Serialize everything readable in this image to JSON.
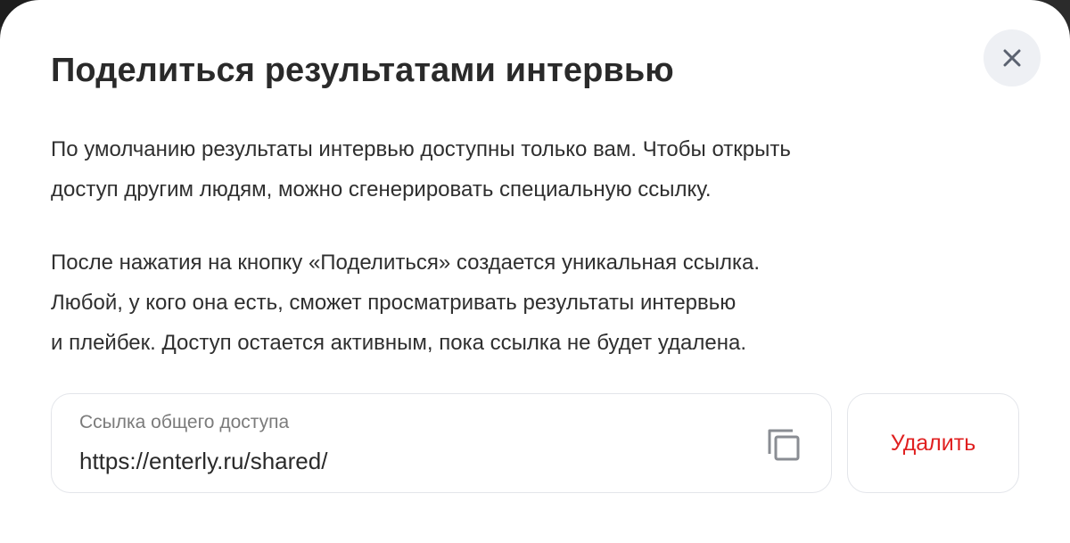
{
  "modal": {
    "title": "Поделиться результатами интервью",
    "close_icon": "close-icon",
    "paragraph1": [
      "По умолчанию результаты интервью доступны только вам. Чтобы открыть",
      "доступ другим людям, можно сгенерировать специальную ссылку."
    ],
    "paragraph2": [
      "После нажатия на кнопку «Поделиться» создается уникальная ссылка.",
      "Любой, у кого она есть, сможет просматривать результаты интервью",
      "и плейбек. Доступ остается активным, пока ссылка не будет удалена."
    ],
    "link_field": {
      "label": "Ссылка общего доступа",
      "value": "https://enterly.ru/shared/",
      "copy_icon": "copy-icon"
    },
    "delete_button": "Удалить"
  },
  "colors": {
    "delete_text": "#e02020",
    "close_bg": "#eef0f4",
    "field_border": "#e3e5ea"
  }
}
